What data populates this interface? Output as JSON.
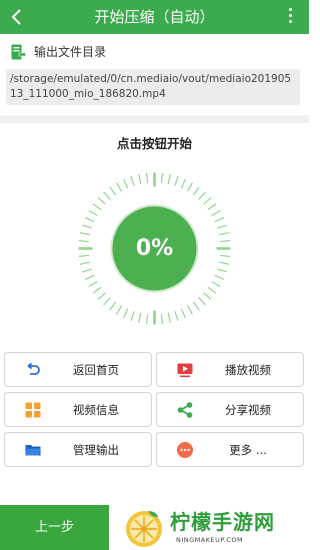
{
  "header": {
    "title": "开始压缩（自动）"
  },
  "output": {
    "label": "输出文件目录",
    "path": "/storage/emulated/0/cn.mediaio/vout/mediaio20190513_111000_mio_186820.mp4"
  },
  "main": {
    "prompt": "点击按钮开始",
    "progress_text": "0%",
    "progress_value": 0
  },
  "actions": [
    {
      "label": "返回首页",
      "icon": "undo-arrow-icon"
    },
    {
      "label": "播放视频",
      "icon": "video-play-icon"
    },
    {
      "label": "视频信息",
      "icon": "grid-info-icon"
    },
    {
      "label": "分享视频",
      "icon": "share-icon"
    },
    {
      "label": "管理输出",
      "icon": "folder-icon"
    },
    {
      "label": "更多 ...",
      "icon": "more-dots-icon"
    }
  ],
  "footer": {
    "prev_label": "上一步"
  },
  "watermark": {
    "brand": "柠檬手游网",
    "domain": "NINGMAKEUP.COM"
  },
  "colors": {
    "accent": "#3bab4d",
    "dial": "#4caf50",
    "ticks": "#8fd68f",
    "orange": "#f5a030",
    "red": "#e04040",
    "blue": "#2b6fd6"
  }
}
